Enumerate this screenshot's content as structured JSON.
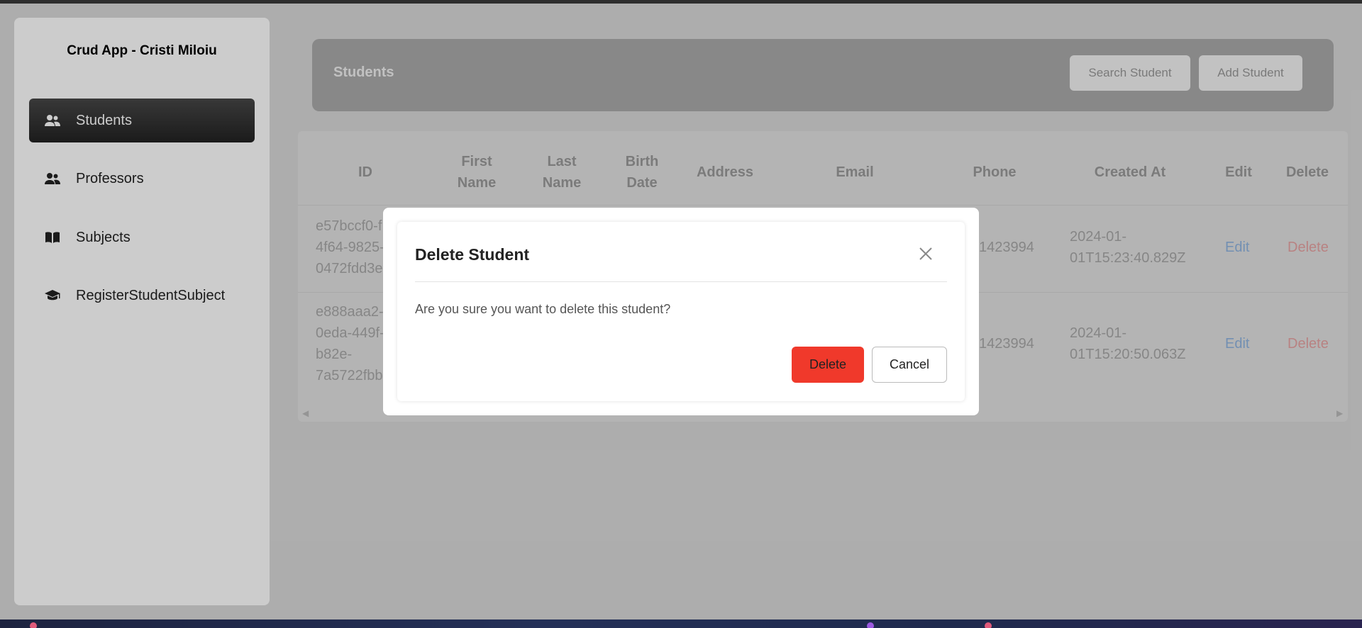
{
  "app": {
    "brand": "Crud App - Cristi Miloiu"
  },
  "sidebar": {
    "items": [
      {
        "label": "Students",
        "icon": "users-icon",
        "active": true
      },
      {
        "label": "Professors",
        "icon": "users-icon",
        "active": false
      },
      {
        "label": "Subjects",
        "icon": "book-icon",
        "active": false
      },
      {
        "label": "RegisterStudentSubject",
        "icon": "graduation-cap-icon",
        "active": false
      }
    ]
  },
  "header": {
    "title": "Students",
    "search_label": "Search Student",
    "add_label": "Add Student"
  },
  "table": {
    "columns": [
      "ID",
      "First Name",
      "Last Name",
      "Birth Date",
      "Address",
      "Email",
      "Phone",
      "Created At",
      "Edit",
      "Delete"
    ],
    "rows": [
      {
        "id": "e57bccf0-f… 4f64-9825-… 0472fdd3e…",
        "id_lines": [
          "e57bccf0-f",
          "4f64-9825-",
          "0472fdd3e"
        ],
        "phone": "1423994",
        "created_lines": [
          "2024-01-",
          "01T15:23:40.829Z"
        ],
        "edit": "Edit",
        "delete": "Delete"
      },
      {
        "id_lines": [
          "e888aaa2-",
          "0eda-449f-",
          "b82e-",
          "7a5722fbb"
        ],
        "phone": "1423994",
        "created_lines": [
          "2024-01-",
          "01T15:20:50.063Z"
        ],
        "edit": "Edit",
        "delete": "Delete"
      }
    ]
  },
  "modal": {
    "title": "Delete Student",
    "message": "Are you sure you want to delete this student?",
    "confirm_label": "Delete",
    "cancel_label": "Cancel"
  },
  "colors": {
    "danger": "#f0392b",
    "link": "#4a90e2",
    "active_nav": "#2b2b2b"
  }
}
